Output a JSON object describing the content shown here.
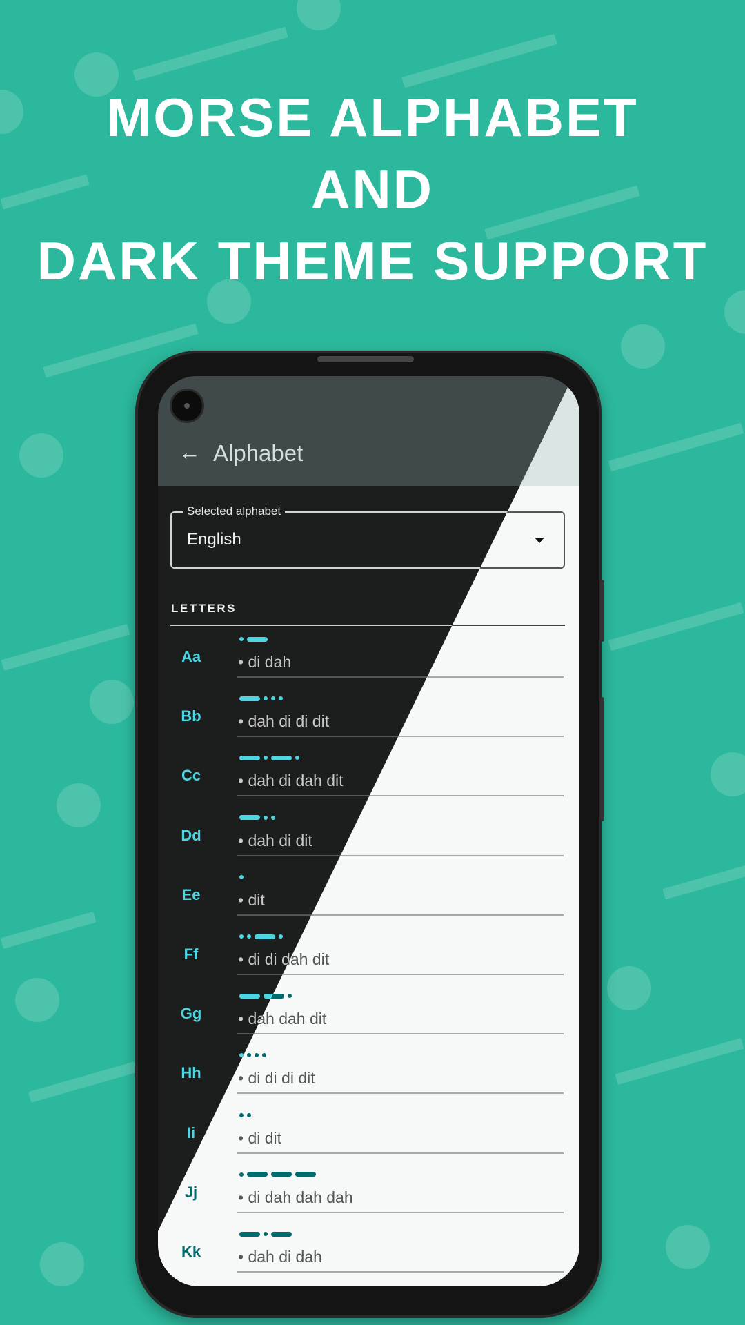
{
  "headline": {
    "line1": "MORSE ALPHABET",
    "line2": "AND",
    "line3": "DARK THEME SUPPORT"
  },
  "app": {
    "title": "Alphabet",
    "back_icon": "arrow-left-icon",
    "dropdown": {
      "label": "Selected alphabet",
      "value": "English"
    },
    "section": "LETTERS",
    "letters": [
      {
        "letter": "Aa",
        "morse": ".-",
        "words": "• di dah"
      },
      {
        "letter": "Bb",
        "morse": "-...",
        "words": "• dah di di dit"
      },
      {
        "letter": "Cc",
        "morse": "-.-.",
        "words": "• dah di dah dit"
      },
      {
        "letter": "Dd",
        "morse": "-..",
        "words": "• dah di dit"
      },
      {
        "letter": "Ee",
        "morse": ".",
        "words": "• dit"
      },
      {
        "letter": "Ff",
        "morse": "..-.",
        "words": "• di di dah dit"
      },
      {
        "letter": "Gg",
        "morse": "--.",
        "words": "• dah dah dit"
      },
      {
        "letter": "Hh",
        "morse": "....",
        "words": "• di di di dit"
      },
      {
        "letter": "Ii",
        "morse": "..",
        "words": "• di dit"
      },
      {
        "letter": "Jj",
        "morse": ".---",
        "words": "• di dah dah dah"
      },
      {
        "letter": "Kk",
        "morse": "-.-",
        "words": "• dah di dah"
      }
    ]
  },
  "colors": {
    "background": "#2bb89c",
    "accent_dark": "#4dd5e1",
    "accent_light": "#006a6c",
    "appbar_dark": "#414a4a",
    "appbar_light": "#dbe6e4"
  }
}
